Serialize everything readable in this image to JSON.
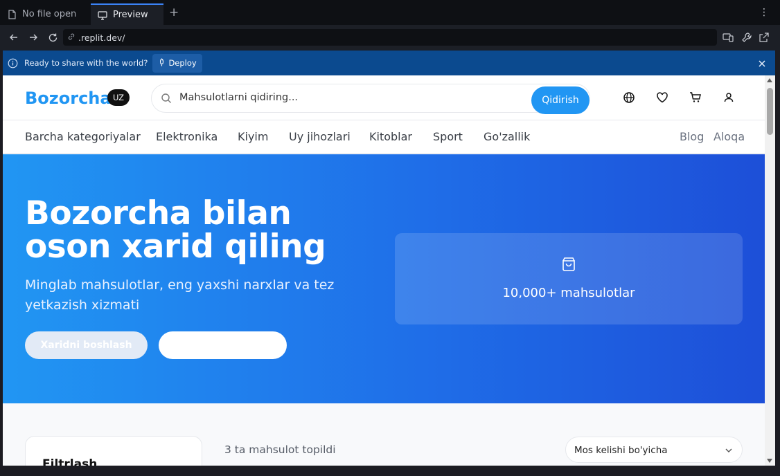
{
  "browser": {
    "tabs": [
      {
        "label": "No file open",
        "icon": "file-icon"
      },
      {
        "label": "Preview",
        "icon": "monitor-icon"
      }
    ],
    "url": ".replit.dev/"
  },
  "banner": {
    "message": "Ready to share with the world?",
    "deploy_label": "Deploy"
  },
  "header": {
    "logo": "Bozorcha",
    "lang": "UZ",
    "search_placeholder": "Mahsulotlarni qidiring...",
    "search_button": "Qidirish"
  },
  "nav": {
    "categories": [
      "Barcha kategoriyalar",
      "Elektronika",
      "Kiyim",
      "Uy jihozlari",
      "Kitoblar",
      "Sport",
      "Go'zallik"
    ],
    "links": [
      "Blog",
      "Aloqa"
    ]
  },
  "hero": {
    "title": "Bozorcha bilan oson xarid qiling",
    "subtitle": "Minglab mahsulotlar, eng yaxshi narxlar va tez yetkazish xizmati",
    "primary_button": "Xaridni boshlash",
    "stat": "10,000+ mahsulotlar"
  },
  "listing": {
    "filter_title": "Filtrlash",
    "result_count": "3 ta mahsulot topildi",
    "sort_value": "Mos kelishi bo'yicha"
  },
  "colors": {
    "brand": "#2196f3",
    "hero_end": "#1d4fd8"
  }
}
